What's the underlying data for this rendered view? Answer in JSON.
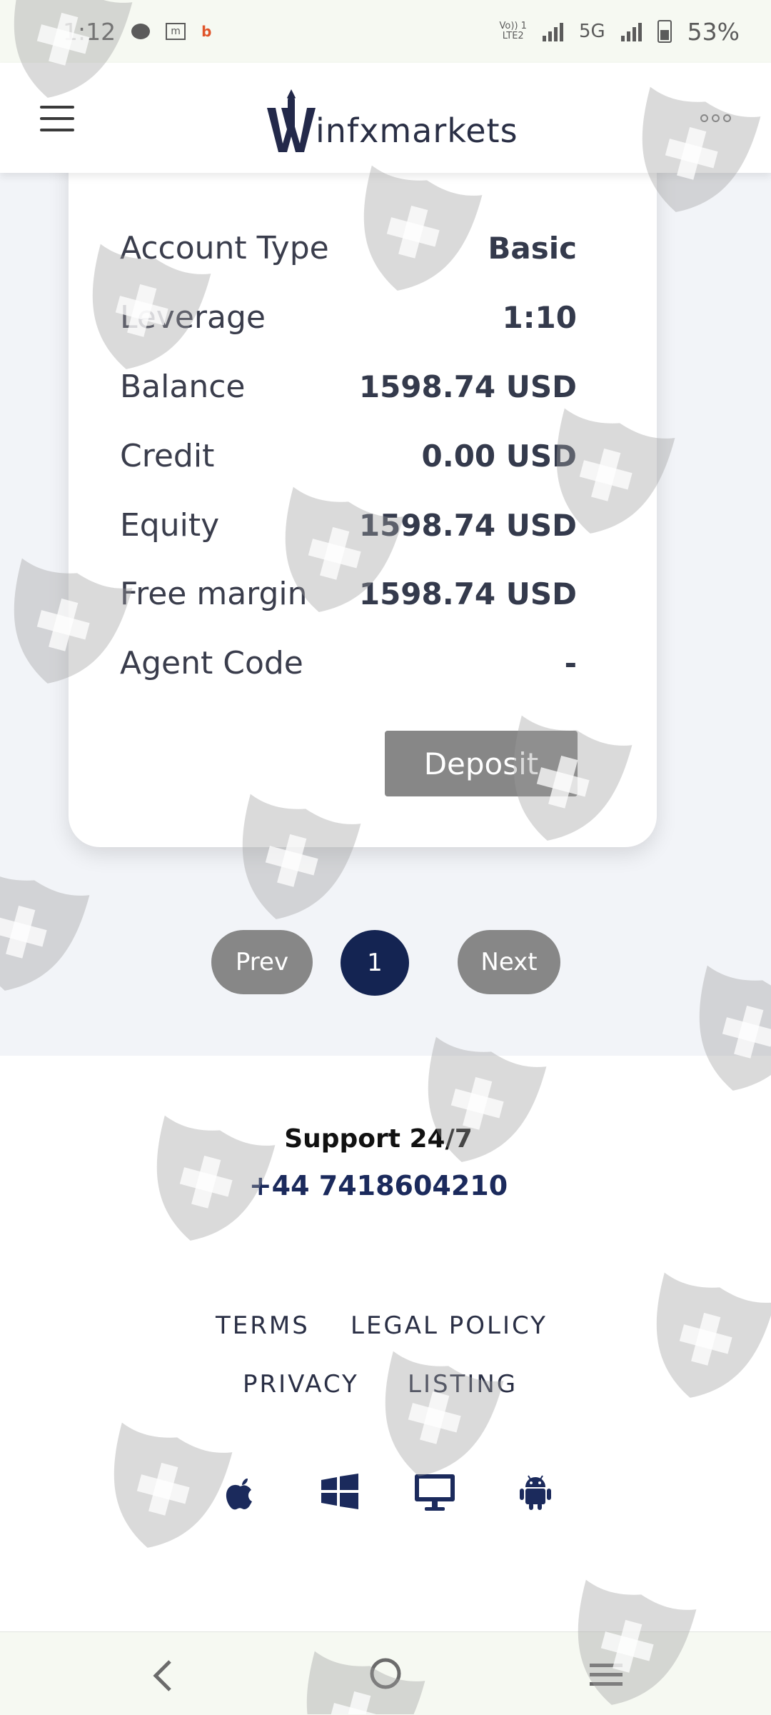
{
  "status_bar": {
    "time": "1:12",
    "network_label_1": "Vo)) 1",
    "network_label_2": "LTE2",
    "network_type": "5G",
    "battery": "53%"
  },
  "header": {
    "brand_name": "infxmarkets",
    "menu_icon": "hamburger-menu-icon",
    "more_icon": "more-dots-icon"
  },
  "account": {
    "rows": [
      {
        "label": "Account Type",
        "value": "Basic"
      },
      {
        "label": "Leverage",
        "value": "1:10"
      },
      {
        "label": "Balance",
        "value": "1598.74 USD"
      },
      {
        "label": "Credit",
        "value": "0.00 USD"
      },
      {
        "label": "Equity",
        "value": "1598.74 USD"
      },
      {
        "label": "Free margin",
        "value": "1598.74 USD"
      },
      {
        "label": "Agent Code",
        "value": "-"
      }
    ],
    "deposit_label": "Deposit"
  },
  "pagination": {
    "prev_label": "Prev",
    "current_page": "1",
    "next_label": "Next"
  },
  "footer": {
    "support_title": "Support 24/7",
    "support_phone": "+44 7418604210",
    "links": {
      "terms": "TERMS",
      "legal_policy": "LEGAL POLICY",
      "privacy": "PRIVACY",
      "listing": "LISTING"
    },
    "platforms": [
      "apple-icon",
      "windows-icon",
      "desktop-icon",
      "android-icon"
    ]
  },
  "colors": {
    "brand_navy": "#142452",
    "button_gray": "#878787",
    "page_background": "#f2f4f8"
  }
}
